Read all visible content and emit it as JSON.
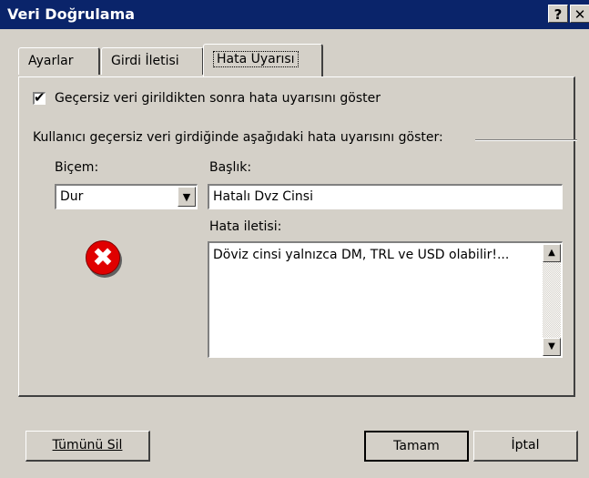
{
  "window": {
    "title": "Veri Doğrulama",
    "help_glyph": "?",
    "close_glyph": "✕"
  },
  "tabs": [
    {
      "label": "Ayarlar"
    },
    {
      "label": "Girdi İletisi"
    },
    {
      "label": "Hata Uyarısı",
      "active": true
    }
  ],
  "error_alert": {
    "show_checkbox": {
      "checked": true,
      "label": "Geçersiz veri girildikten sonra hata uyarısını göster"
    },
    "section_label": "Kullanıcı geçersiz veri girdiğinde aşağıdaki hata uyarısını göster:",
    "style": {
      "label": "Biçem:",
      "value": "Dur"
    },
    "title": {
      "label": "Başlık:",
      "value": "Hatalı Dvz Cinsi"
    },
    "message": {
      "label": "Hata iletisi:",
      "value": "Döviz cinsi yalnızca DM, TRL ve USD olabilir!..."
    },
    "icon": "error-stop-icon",
    "icon_glyph": "✖"
  },
  "buttons": {
    "clear": "Tümünü Sil",
    "ok": "Tamam",
    "cancel": "İptal"
  },
  "colors": {
    "titlebar": "#0a246a",
    "dialog_bg": "#d4d0c8",
    "error_icon": "#e00000"
  }
}
